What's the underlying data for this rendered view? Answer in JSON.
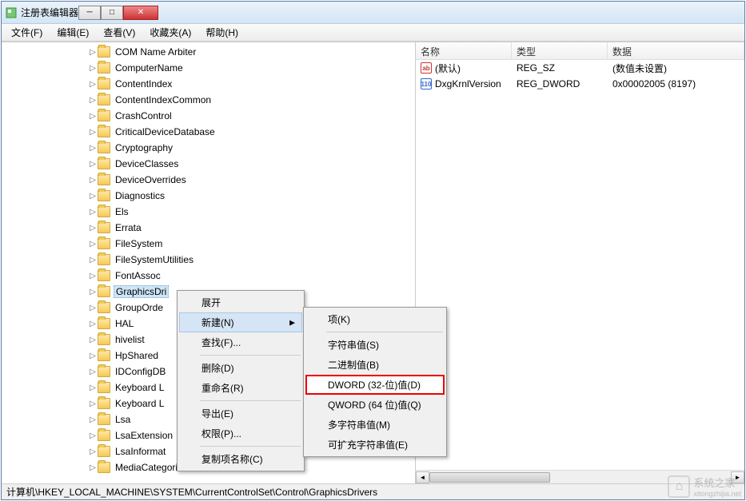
{
  "window": {
    "title": "注册表编辑器"
  },
  "menubar": [
    {
      "label": "文件(F)"
    },
    {
      "label": "编辑(E)"
    },
    {
      "label": "查看(V)"
    },
    {
      "label": "收藏夹(A)"
    },
    {
      "label": "帮助(H)"
    }
  ],
  "tree": {
    "indent_base": 108,
    "items": [
      {
        "label": "COM Name Arbiter"
      },
      {
        "label": "ComputerName"
      },
      {
        "label": "ContentIndex"
      },
      {
        "label": "ContentIndexCommon"
      },
      {
        "label": "CrashControl"
      },
      {
        "label": "CriticalDeviceDatabase"
      },
      {
        "label": "Cryptography"
      },
      {
        "label": "DeviceClasses"
      },
      {
        "label": "DeviceOverrides"
      },
      {
        "label": "Diagnostics"
      },
      {
        "label": "Els"
      },
      {
        "label": "Errata"
      },
      {
        "label": "FileSystem"
      },
      {
        "label": "FileSystemUtilities"
      },
      {
        "label": "FontAssoc"
      },
      {
        "label": "GraphicsDri",
        "selected": true
      },
      {
        "label": "GroupOrde"
      },
      {
        "label": "HAL"
      },
      {
        "label": "hivelist"
      },
      {
        "label": "HpShared"
      },
      {
        "label": "IDConfigDB"
      },
      {
        "label": "Keyboard L"
      },
      {
        "label": "Keyboard L"
      },
      {
        "label": "Lsa"
      },
      {
        "label": "LsaExtension"
      },
      {
        "label": "LsaInformat"
      },
      {
        "label": "MediaCategories"
      }
    ]
  },
  "list": {
    "headers": {
      "name": "名称",
      "type": "类型",
      "data": "数据"
    },
    "col_widths": {
      "name": 120,
      "type": 120,
      "data": 160
    },
    "rows": [
      {
        "icon": "str",
        "name": "(默认)",
        "type": "REG_SZ",
        "data": "(数值未设置)"
      },
      {
        "icon": "bin",
        "name": "DxgKrnlVersion",
        "type": "REG_DWORD",
        "data": "0x00002005 (8197)"
      }
    ]
  },
  "context_menu_1": {
    "items": [
      {
        "label": "展开",
        "type": "item"
      },
      {
        "label": "新建(N)",
        "type": "submenu",
        "highlight": true
      },
      {
        "label": "查找(F)...",
        "type": "item"
      },
      {
        "type": "sep"
      },
      {
        "label": "删除(D)",
        "type": "item"
      },
      {
        "label": "重命名(R)",
        "type": "item"
      },
      {
        "type": "sep"
      },
      {
        "label": "导出(E)",
        "type": "item"
      },
      {
        "label": "权限(P)...",
        "type": "item"
      },
      {
        "type": "sep"
      },
      {
        "label": "复制项名称(C)",
        "type": "item"
      }
    ]
  },
  "context_menu_2": {
    "items": [
      {
        "label": "项(K)",
        "type": "item"
      },
      {
        "type": "sep"
      },
      {
        "label": "字符串值(S)",
        "type": "item"
      },
      {
        "label": "二进制值(B)",
        "type": "item"
      },
      {
        "label": "DWORD (32-位)值(D)",
        "type": "item",
        "redbox": true
      },
      {
        "label": "QWORD (64 位)值(Q)",
        "type": "item"
      },
      {
        "label": "多字符串值(M)",
        "type": "item"
      },
      {
        "label": "可扩充字符串值(E)",
        "type": "item"
      }
    ]
  },
  "statusbar": {
    "path": "计算机\\HKEY_LOCAL_MACHINE\\SYSTEM\\CurrentControlSet\\Control\\GraphicsDrivers"
  },
  "watermark": {
    "text": "系统之家",
    "sub": "xitongzhijia.net"
  },
  "win_buttons": {
    "min": "─",
    "max": "□",
    "close": "✕"
  }
}
